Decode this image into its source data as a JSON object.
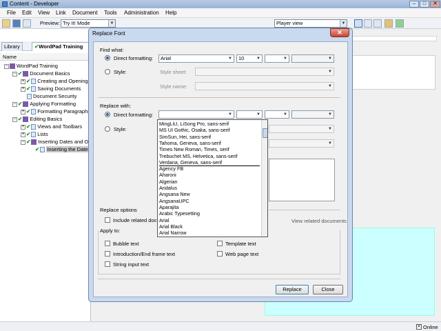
{
  "window": {
    "title": "Content - Developer",
    "min": "–",
    "max": "□",
    "close": "✕"
  },
  "menu": [
    "File",
    "Edit",
    "View",
    "Link",
    "Document",
    "Tools",
    "Administration",
    "Help"
  ],
  "toolbar": {
    "preview_label": "Preview:",
    "preview_mode": "Try It! Mode",
    "view_mode": "Player view"
  },
  "left": {
    "tabs": [
      "Library",
      "WordPad Training"
    ],
    "name_header": "Name",
    "tree": [
      {
        "label": "WordPad Training",
        "level": 0,
        "exp": "−",
        "check": false,
        "icon": "book"
      },
      {
        "label": "Document Basics",
        "level": 1,
        "exp": "−",
        "check": true,
        "icon": "book"
      },
      {
        "label": "Creating and Opening D",
        "level": 2,
        "exp": "+",
        "check": true,
        "icon": "page"
      },
      {
        "label": "Saving Documents",
        "level": 2,
        "exp": "+",
        "check": true,
        "icon": "page"
      },
      {
        "label": "Document Security",
        "level": 2,
        "exp": "",
        "check": false,
        "icon": "page"
      },
      {
        "label": "Applying Formatting",
        "level": 1,
        "exp": "−",
        "check": true,
        "icon": "book"
      },
      {
        "label": "Formatting Paragraphs",
        "level": 2,
        "exp": "+",
        "check": true,
        "icon": "page"
      },
      {
        "label": "Editing Basics",
        "level": 1,
        "exp": "−",
        "check": true,
        "icon": "book"
      },
      {
        "label": "Views and Toolbars",
        "level": 2,
        "exp": "+",
        "check": true,
        "icon": "page"
      },
      {
        "label": "Lists",
        "level": 2,
        "exp": "+",
        "check": true,
        "icon": "page"
      },
      {
        "label": "Inserting Dates and Obj",
        "level": 2,
        "exp": "−",
        "check": true,
        "icon": "book"
      },
      {
        "label": "Inserting the Date",
        "level": 3,
        "exp": "",
        "check": true,
        "icon": "page",
        "selected": true
      }
    ]
  },
  "status": {
    "online": "Online"
  },
  "dialog": {
    "title": "Replace Font",
    "find_what": "Find what:",
    "direct_formatting": "Direct formatting:",
    "find_font": "Arial",
    "find_size": "10",
    "style": "Style:",
    "style_sheet": "Style sheet:",
    "style_name": "Style name:",
    "replace_with": "Replace with:",
    "view_related": "View related documents",
    "replace_options": "Replace options",
    "include_related": "Include related docume",
    "apply_to": "Apply to:",
    "apply_items": [
      "Bubble text",
      "Template text",
      "Introduction/End frame text",
      "Web page text",
      "String input text"
    ],
    "replace_btn": "Replace",
    "close_btn": "Close",
    "font_list": [
      "MingLiU, LiSong Pro, sans-serif",
      "MS UI Gothic, Osaka, sans-serif",
      "SimSun, Hei, sans-serif",
      "Tahoma, Geneva, sans-serif",
      "Times New Roman, Times, serif",
      "Trebuchet MS, Helvetica, sans-serif",
      "Verdana, Geneva, sans-serif",
      "Agency FB",
      "Aharoni",
      "Algerian",
      "Andalus",
      "Angsana New",
      "AngsanaUPC",
      "Aparajita",
      "Arabic Typesetting",
      "Arial",
      "Arial Black",
      "Arial Narrow"
    ]
  }
}
